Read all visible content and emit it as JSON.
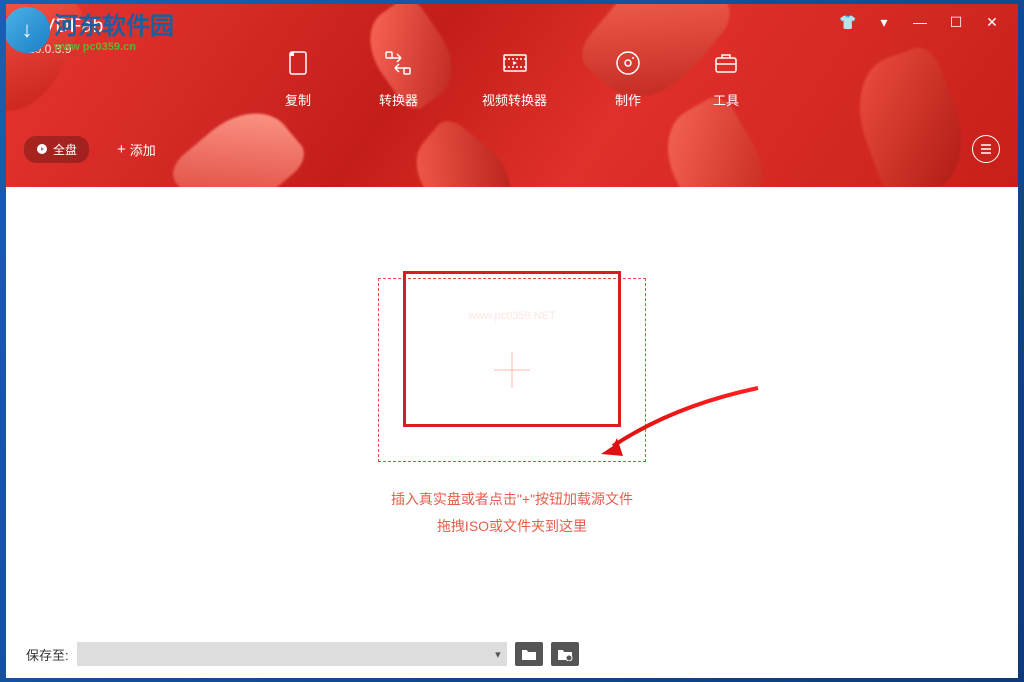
{
  "watermark": {
    "badge": "↓",
    "title": "河东软件园",
    "url": "www pc0359.cn"
  },
  "brand": {
    "name": "DVDFab",
    "version": "10.0.3.9"
  },
  "windowControls": {
    "shirt": "👕",
    "dropdown": "▾",
    "minimize": "—",
    "maximize": "☐",
    "close": "✕"
  },
  "nav": {
    "copy": "复制",
    "converter": "转换器",
    "videoConverter": "视频转换器",
    "creator": "制作",
    "tools": "工具"
  },
  "toolbar": {
    "fullDisc": "全盘",
    "add": "添加"
  },
  "dropzone": {
    "centerWatermark": "www.pc0359.NET",
    "line1": "插入真实盘或者点击\"+\"按钮加载源文件",
    "line2": "拖拽ISO或文件夹到这里"
  },
  "footer": {
    "saveTo": "保存至:",
    "dropdownCaret": "▾"
  }
}
